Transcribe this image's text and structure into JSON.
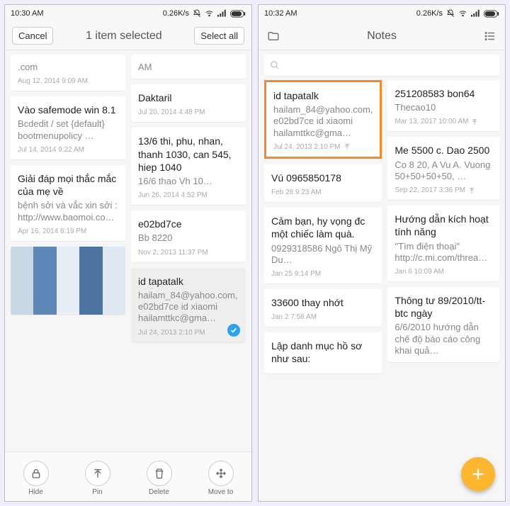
{
  "status": {
    "left_time": "10:30 AM",
    "right_time": "10:32 AM",
    "speed": "0.26K/s"
  },
  "left": {
    "cancel": "Cancel",
    "title": "1 item selected",
    "select_all": "Select all",
    "actions": {
      "hide": "Hide",
      "pin": "Pin",
      "delete": "Delete",
      "move": "Move to"
    },
    "colA": [
      {
        "title": "",
        "body": ".com",
        "date": "Aug 12, 2014 9:09 AM"
      },
      {
        "title": "Vào safemode win 8.1",
        "body": "Bcdedit / set {default} bootmenupolicy …",
        "date": "Jul 14, 2014 9:22 AM"
      },
      {
        "title": "Giải đáp mọi thắc mắc của mẹ về",
        "body": "bệnh sởi và vắc xin sởi : http://www.baomoi.co…",
        "date": "Apr 16, 2014 8:19 PM"
      },
      {
        "image": true
      }
    ],
    "colB": [
      {
        "title": "",
        "body": "AM",
        "date": ""
      },
      {
        "title": "Daktaril",
        "body": "",
        "date": "Jul 20, 2014 4:48 PM"
      },
      {
        "title": "13/6 thi, phu, nhan, thanh 1030, can 545, hiep 1040",
        "body": "16/6 thao Vh 10…",
        "date": "Jun 26, 2014 4:52 PM"
      },
      {
        "title": "e02bd7ce",
        "body": "Bb 8220",
        "date": "Nov 2, 2013 11:37 PM"
      },
      {
        "title": "id tapatalk",
        "body": "hailam_84@yahoo.com, e02bd7ce id xiaomi hailamttkc@gma…",
        "date": "Jul 24, 2013 2:10 PM",
        "selected": true
      }
    ]
  },
  "right": {
    "title": "Notes",
    "search_placeholder": "Q",
    "colA": [
      {
        "title": "id tapatalk",
        "body": "hailam_84@yahoo.com, e02bd7ce id xiaomi hailamttkc@gma…",
        "date": "Jul 24, 2013 2:10 PM",
        "highlight": true,
        "pin": true
      },
      {
        "title": "Vú 0965850178",
        "body": "",
        "date": "Feb 28 9:23 AM"
      },
      {
        "title": "Cảm bạn, hy vọng đc một chiếc làm quà.",
        "body": "0929318586 Ngô Thị Mỹ Du…",
        "date": "Jan 25 9:14 PM"
      },
      {
        "title": "33600 thay nhớt",
        "body": "",
        "date": "Jan 2 7:58 AM"
      },
      {
        "title": "Lập danh mục hồ sơ như sau:",
        "body": "",
        "date": ""
      }
    ],
    "colB": [
      {
        "title": "251208583 bon64",
        "body": "Thecao10",
        "date": "Mar 13, 2017 10:00 AM",
        "pin": true
      },
      {
        "title": "Me 5500 c. Dao 2500",
        "body": "Co 8 20,  A Vu A. Vuong 50+50+50+50, …",
        "date": "Sep 22, 2017 3:36 PM",
        "pin": true
      },
      {
        "title": "Hướng dẫn kích hoạt tính năng",
        "body": "&quot;Tìm điện thoại&quot; http://c.mi.com/threa…",
        "date": "Jan 6 10:09 AM"
      },
      {
        "title": "Thông tư 89/2010/tt-btc ngày",
        "body": "6/6/2010 hướng dẫn chế độ báo cáo công khai quả…",
        "date": ""
      }
    ]
  }
}
